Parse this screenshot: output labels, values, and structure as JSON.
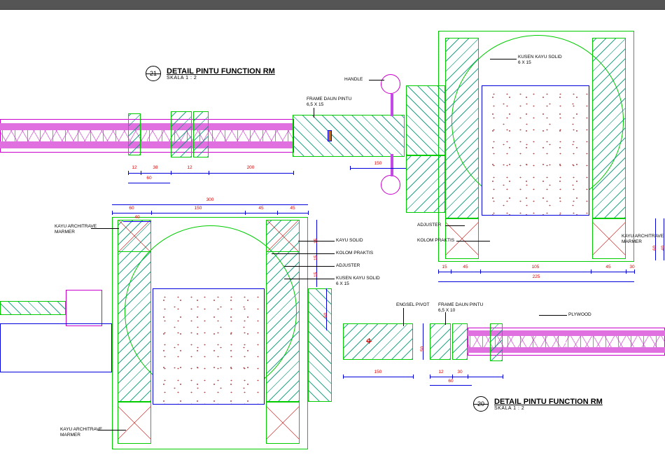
{
  "titles": {
    "t21_num": "21",
    "t21": "DETAIL PINTU FUNCTION RM",
    "t21_scale": "SKALA   1 : 2",
    "t20_num": "20",
    "t20": "DETAIL PINTU FUNCTION RM",
    "t20_scale": "SKALA   1 : 2"
  },
  "labels": {
    "handle": "HANDLE",
    "frame_daun": "FRAME DAUN PINTU",
    "frame_daun_size": "6,5 X 15",
    "kusen": "KUSEN KAYU SOLID",
    "kusen_size": "6 X 15",
    "adjuster": "ADJUSTER",
    "kolom": "KOLOM PRAKTIS",
    "kayu_solid": "KAYU SOLID",
    "architrave": "KAYU ARCHITRAVE",
    "architrave2": "MARMER",
    "engsel": "ENGSEL PIVOT",
    "frame_daun2": "FRAME DAUN PINTU",
    "frame_daun2_size": "6,5 X 10",
    "plywood": "PLYWOOD"
  },
  "dims": {
    "a_left_38": "38",
    "a_left_12a": "12",
    "a_left_12b": "12",
    "a_span_200": "200",
    "a_left_60": "60",
    "a_mid_150": "150",
    "ur_15": "15",
    "ur_45a": "45",
    "ur_105": "105",
    "ur_45b": "45",
    "ur_30": "30",
    "ur_225": "225",
    "ur_right_60": "60",
    "ur_right_40": "40",
    "bl_top_300": "300",
    "bl_60": "60",
    "bl_150": "150",
    "bl_45a": "45",
    "bl_45b": "45",
    "bl_40": "40",
    "bl_s15a": "15",
    "bl_s15b": "15",
    "bl_s15c": "15",
    "bl_s60": "60",
    "br_150": "150",
    "br_12": "12",
    "br_30": "30",
    "br_60": "60",
    "br_s50": "50"
  }
}
